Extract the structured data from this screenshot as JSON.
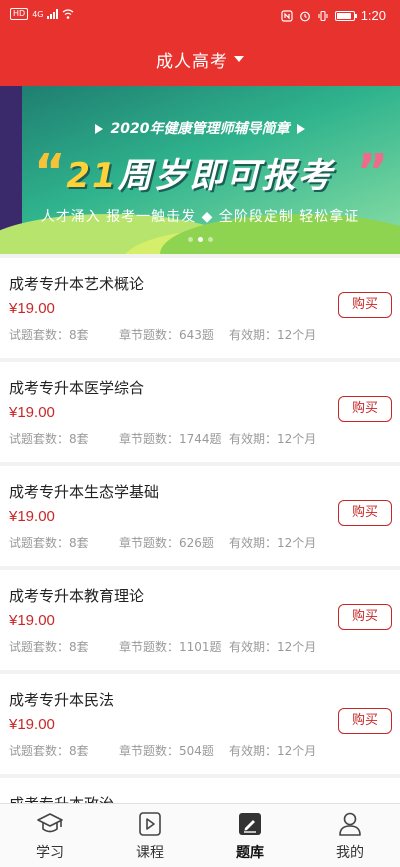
{
  "status_bar": {
    "hd": "HD",
    "network": "4G",
    "time": "1:20"
  },
  "header": {
    "title": "成人高考"
  },
  "banner": {
    "top_line": "2020年健康管理师辅导简章",
    "headline_num": "21",
    "headline_text": "周岁即可报考",
    "subline": "人才涌入 报考一触击发 ◆ 全阶段定制 轻松拿证"
  },
  "courses": [
    {
      "name": "成考专升本艺术概论",
      "price": "¥19.00",
      "sets": "试题套数：8套",
      "chapters": "章节题数：643题",
      "validity": "有效期：12个月",
      "buy": "购买"
    },
    {
      "name": "成考专升本医学综合",
      "price": "¥19.00",
      "sets": "试题套数：8套",
      "chapters": "章节题数：1744题",
      "validity": "有效期：12个月",
      "buy": "购买"
    },
    {
      "name": "成考专升本生态学基础",
      "price": "¥19.00",
      "sets": "试题套数：8套",
      "chapters": "章节题数：626题",
      "validity": "有效期：12个月",
      "buy": "购买"
    },
    {
      "name": "成考专升本教育理论",
      "price": "¥19.00",
      "sets": "试题套数：8套",
      "chapters": "章节题数：1101题",
      "validity": "有效期：12个月",
      "buy": "购买"
    },
    {
      "name": "成考专升本民法",
      "price": "¥19.00",
      "sets": "试题套数：8套",
      "chapters": "章节题数：504题",
      "validity": "有效期：12个月",
      "buy": "购买"
    }
  ],
  "partial_course": {
    "name": "成考专升本政治"
  },
  "tabbar": [
    {
      "label": "学习",
      "icon": "graduation-cap-icon",
      "active": false
    },
    {
      "label": "课程",
      "icon": "play-icon",
      "active": false
    },
    {
      "label": "题库",
      "icon": "edit-book-icon",
      "active": true
    },
    {
      "label": "我的",
      "icon": "user-icon",
      "active": false
    }
  ]
}
